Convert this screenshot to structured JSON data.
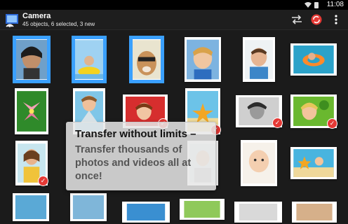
{
  "status_bar": {
    "time": "11:08",
    "icons": [
      "wifi-icon",
      "battery-icon"
    ]
  },
  "app_bar": {
    "title": "Camera",
    "subtitle": "45 objects, 6 selected, 3 new",
    "actions": [
      "transfer-arrows-icon",
      "sync-icon",
      "overflow-menu-icon"
    ]
  },
  "thumbnails": [
    {
      "row": 0,
      "col": 0,
      "selected": true,
      "checked": false
    },
    {
      "row": 0,
      "col": 1,
      "selected": true,
      "checked": false
    },
    {
      "row": 0,
      "col": 2,
      "selected": true,
      "checked": false
    },
    {
      "row": 0,
      "col": 3,
      "selected": false,
      "checked": false
    },
    {
      "row": 0,
      "col": 4,
      "selected": false,
      "checked": false
    },
    {
      "row": 0,
      "col": 5,
      "selected": false,
      "checked": false
    },
    {
      "row": 1,
      "col": 0,
      "selected": false,
      "checked": false
    },
    {
      "row": 1,
      "col": 1,
      "selected": false,
      "checked": false
    },
    {
      "row": 1,
      "col": 2,
      "selected": false,
      "checked": true
    },
    {
      "row": 1,
      "col": 3,
      "selected": false,
      "checked": true
    },
    {
      "row": 1,
      "col": 4,
      "selected": false,
      "checked": true
    },
    {
      "row": 1,
      "col": 5,
      "selected": false,
      "checked": true
    },
    {
      "row": 2,
      "col": 0,
      "selected": false,
      "checked": true
    },
    {
      "row": 2,
      "col": 3,
      "selected": false,
      "checked": false
    },
    {
      "row": 2,
      "col": 4,
      "selected": false,
      "checked": false
    },
    {
      "row": 2,
      "col": 5,
      "selected": false,
      "checked": false
    }
  ],
  "tooltip": {
    "title": "Transfer without limits –",
    "body": "Transfer thousands of photos and videos all at once!"
  },
  "colors": {
    "selection": "#3aa0ff",
    "check": "#e53935",
    "background": "#1b1b1b"
  }
}
